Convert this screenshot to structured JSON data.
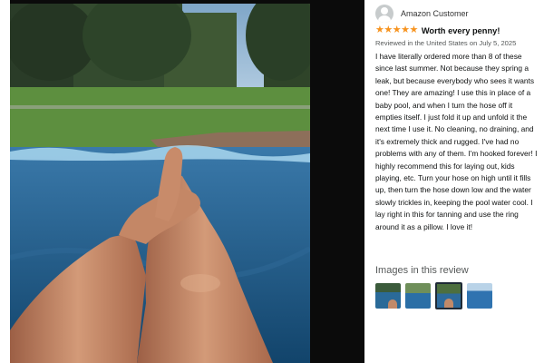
{
  "reviewer": {
    "name": "Amazon Customer",
    "avatar_icon": "user-avatar-icon"
  },
  "review": {
    "rating": 5,
    "stars": "★★★★★",
    "star_color": "#f7931e",
    "title": "Worth every penny!",
    "meta": "Reviewed in the United States on July 5, 2025",
    "body": "I have literally ordered more than 8 of these since last summer. Not because they spring a leak, but because everybody who sees it wants one! They are amazing! I use this in place of a baby pool, and when I turn the hose off it empties itself. I just fold it up and unfold it the next time I use it. No cleaning, no draining, and it's extremely thick and rugged. I've had no problems with any of them. I'm hooked forever! I highly recommend this for laying out, kids playing, etc. Turn your hose on high until it fills up, then turn the hose down low and the water slowly trickles in, keeping the pool water cool. I lay right in this for tanning and use the ring around it as a pillow. I love it!"
  },
  "images_section": {
    "heading": "Images in this review",
    "thumbnails": [
      {
        "label": "thumbnail-1",
        "selected": false
      },
      {
        "label": "thumbnail-2",
        "selected": false
      },
      {
        "label": "thumbnail-3",
        "selected": true
      },
      {
        "label": "thumbnail-4",
        "selected": false
      }
    ]
  }
}
